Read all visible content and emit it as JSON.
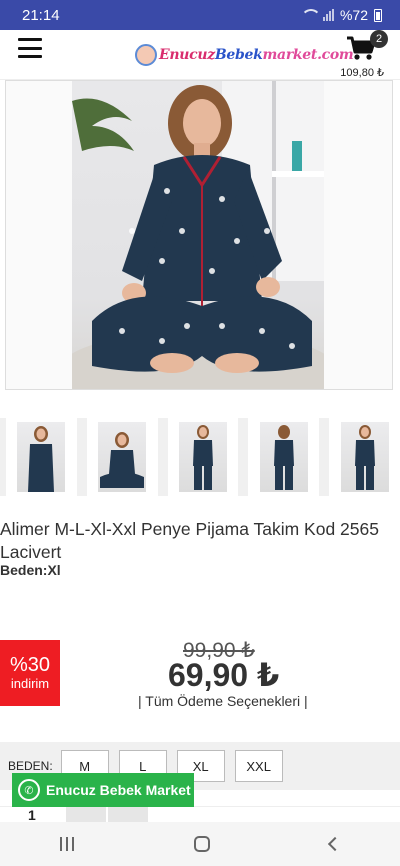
{
  "status_bar": {
    "time": "21:14",
    "battery": "%72"
  },
  "header": {
    "logo_prefix": "Enucuz",
    "logo_mid": "Bebek",
    "logo_suffix": "market.com",
    "cart_count": "2",
    "cart_total": "109,80 ₺"
  },
  "product": {
    "title": "Alimer M-L-Xl-Xxl Penye Pijama Takim Kod 2565 Lacivert",
    "size_line": "Beden:Xl",
    "old_price": "99,90 ₺",
    "new_price": "69,90 ₺",
    "discount_pct": "%30",
    "discount_label": "indirim",
    "payment_options": "| Tüm Ödeme Seçenekleri |"
  },
  "sizes": {
    "label": "BEDEN:",
    "options": [
      "M",
      "L",
      "XL",
      "XXL"
    ]
  },
  "whatsapp": {
    "label": "Enucuz Bebek Market"
  },
  "quantity": {
    "value": "1"
  },
  "colors": {
    "status_bar": "#3a4aa8",
    "discount": "#ee1d23",
    "whatsapp": "#2ab34a",
    "pajama": "#22384f"
  }
}
